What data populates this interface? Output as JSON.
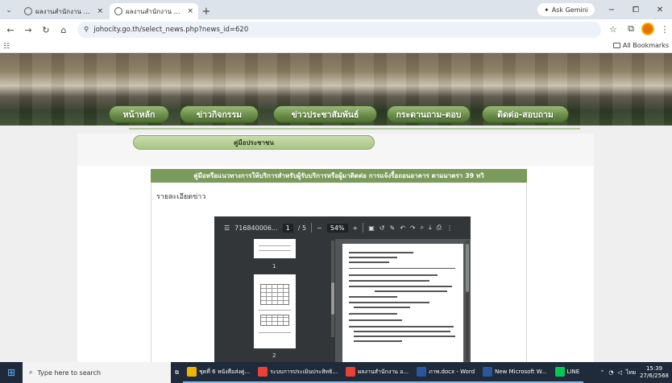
{
  "browser": {
    "tabs": [
      {
        "title": "ผลงานสำนักงาน อำนาจเมืองร้อยเอ็ด",
        "active": false
      },
      {
        "title": "ผลงานสำนักงาน อำนาจเมืองร้อยเอ็ด",
        "active": true
      }
    ],
    "new_tab": "+",
    "gemini_label": "Ask Gemini",
    "address": "johocity.go.th/select_news.php?news_id=620",
    "all_bookmarks": "All Bookmarks",
    "window": {
      "minimize": "−",
      "maximize": "⧠",
      "close": "✕"
    }
  },
  "site": {
    "nav": [
      "หน้าหลัก",
      "ข่าวกิจกรรม",
      "ข่าวประชาสัมพันธ์",
      "กระดานถาม-ตอบ",
      "ติดต่อ-สอบถาม"
    ],
    "section_title": "คู่มือประชาชน",
    "news_header": "คู่มือหรือแนวทางการให้บริการสำหรับผู้รับบริการหรือผู้มาติดต่อ การแจ้งรื้อถอนอาคาร ตามมาตรา 39 ทวิ",
    "detail_label": "รายละเอียดข่าว"
  },
  "pdf_viewer": {
    "filename": "716840006...",
    "current_page": "1",
    "total_pages": "/ 5",
    "zoom": "54%",
    "thumb_labels": [
      "1",
      "2"
    ]
  },
  "taskbar": {
    "search_placeholder": "Type here to search",
    "apps": [
      {
        "label": "ชุดที่ 6 หนังสือส่งคู่...",
        "color": "#f0b400"
      },
      {
        "label": "ระบบการประเมินประสิทธิ...",
        "color": "#e94235"
      },
      {
        "label": "ผลงานสำนักงาน อ...",
        "color": "#e94235"
      },
      {
        "label": "ภาพ.docx - Word",
        "color": "#2b579a"
      },
      {
        "label": "New Microsoft W...",
        "color": "#2b579a"
      },
      {
        "label": "LINE",
        "color": "#06c755"
      }
    ],
    "time": "15:39",
    "date": "27/6/2568",
    "lang": "ไทย"
  }
}
